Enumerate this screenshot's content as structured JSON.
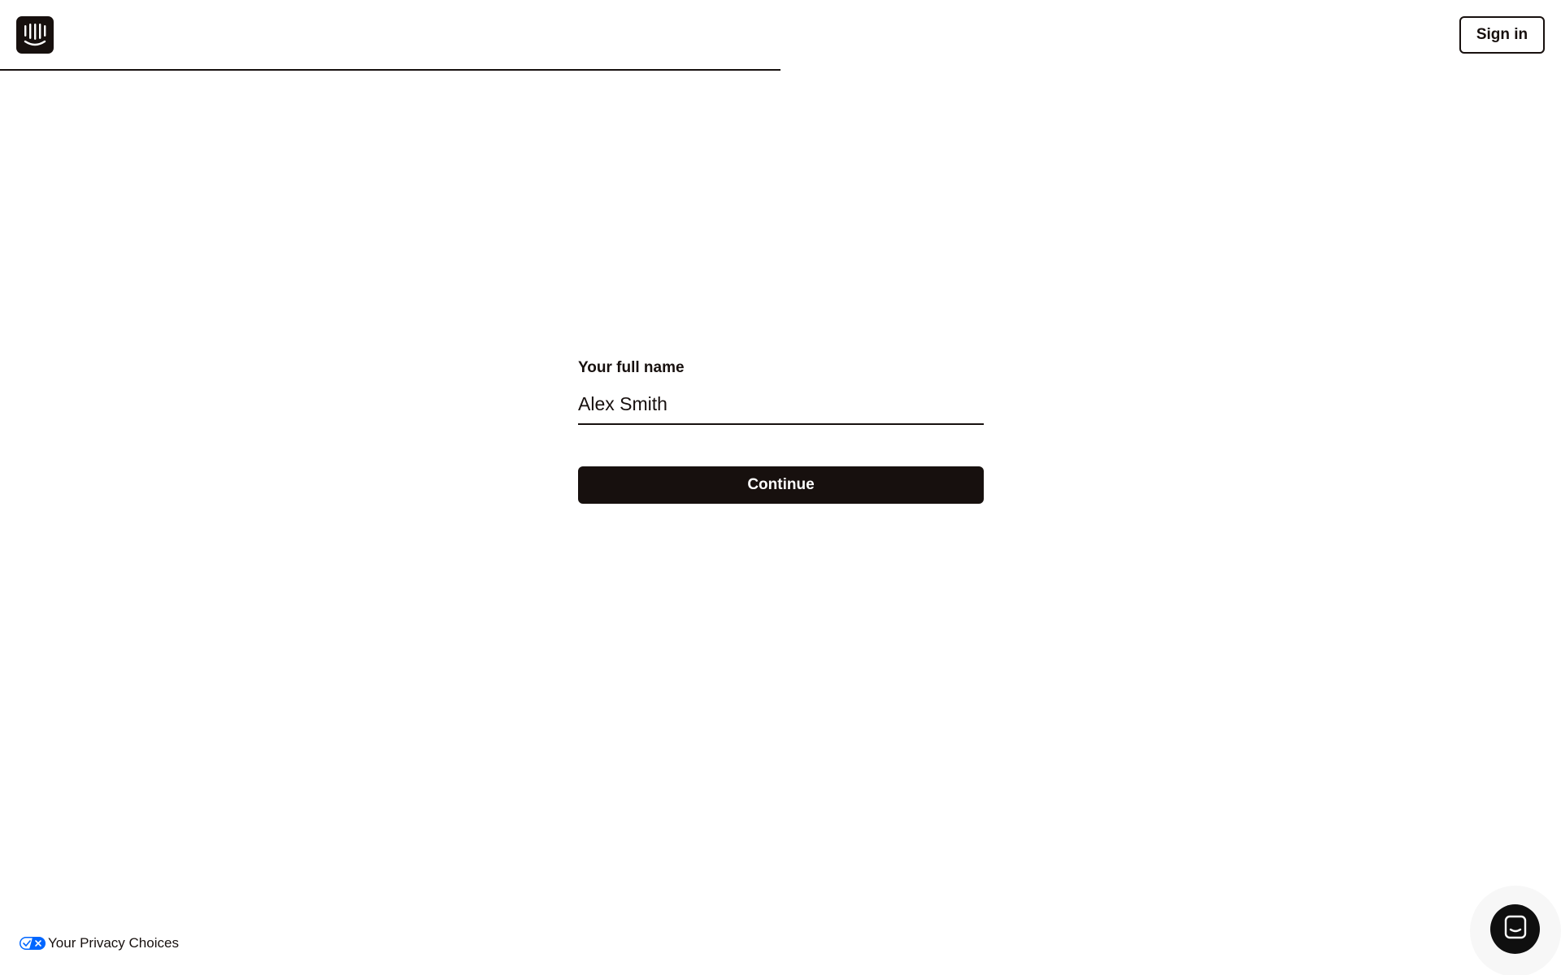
{
  "header": {
    "logo_icon": "intercom-logo-icon",
    "signin_label": "Sign in",
    "progress": 0.5
  },
  "form": {
    "label": "Your full name",
    "name_value": "Alex Smith",
    "continue_label": "Continue"
  },
  "footer": {
    "privacy_label": "Your Privacy Choices",
    "privacy_icon": "privacy-toggle-icon"
  },
  "launcher": {
    "icon": "messenger-icon"
  },
  "colors": {
    "ink": "#17100e",
    "privacy_blue": "#0066ff"
  }
}
